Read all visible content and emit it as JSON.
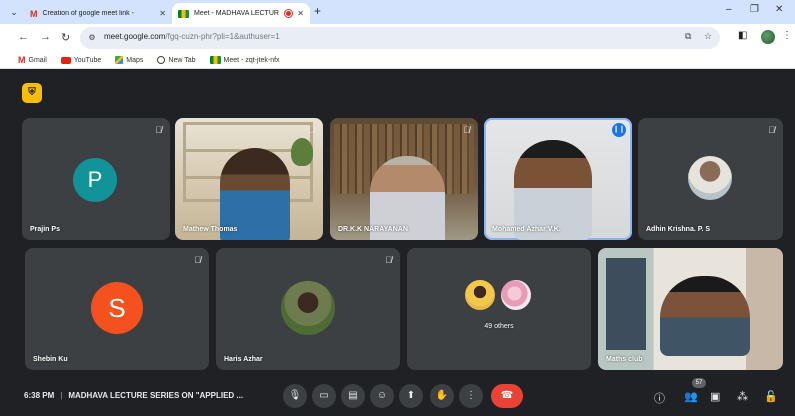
{
  "browser": {
    "tabs": [
      {
        "title": "Creation of google meet link -",
        "active": false
      },
      {
        "title": "Meet - MADHAVA LECTUR",
        "active": true,
        "recording": true
      }
    ],
    "url": {
      "host": "meet.google.com",
      "path": "/fgq-cuzn-phr?pli=1&authuser=1"
    },
    "bookmarks": [
      "Gmail",
      "YouTube",
      "Maps",
      "New Tab",
      "Meet - zqt-jtek-nfx"
    ]
  },
  "participants": {
    "row1": [
      {
        "name": "Prajin Ps",
        "avatar_letter": "P",
        "avatar_color": "#12939a",
        "muted": true
      },
      {
        "name": "Mathew Thomas",
        "video": true,
        "muted": true
      },
      {
        "name": "DR.K.K NARAYANAN",
        "video": true,
        "muted": true
      },
      {
        "name": "Mohamed Azhar V.K.",
        "video": true,
        "speaking": true
      },
      {
        "name": "Adhin Krishna. P. S",
        "photo_avatar": true,
        "muted": true
      }
    ],
    "row2": [
      {
        "name": "Shebin Ku",
        "avatar_letter": "S",
        "avatar_color": "#f4511e",
        "muted": true
      },
      {
        "name": "Haris Azhar",
        "photo_avatar": true,
        "muted": true
      },
      {
        "name": "49 others",
        "group": true
      },
      {
        "name": "Maths club",
        "video": true
      }
    ]
  },
  "meeting": {
    "time": "6:38 PM",
    "separator": "|",
    "title": "MADHAVA LECTURE SERIES ON \"APPLIED ..."
  },
  "controls": [
    "mic",
    "camera",
    "captions",
    "emoji",
    "present",
    "raise-hand",
    "more",
    "leave-call"
  ],
  "right_controls": {
    "people_count": "57"
  }
}
